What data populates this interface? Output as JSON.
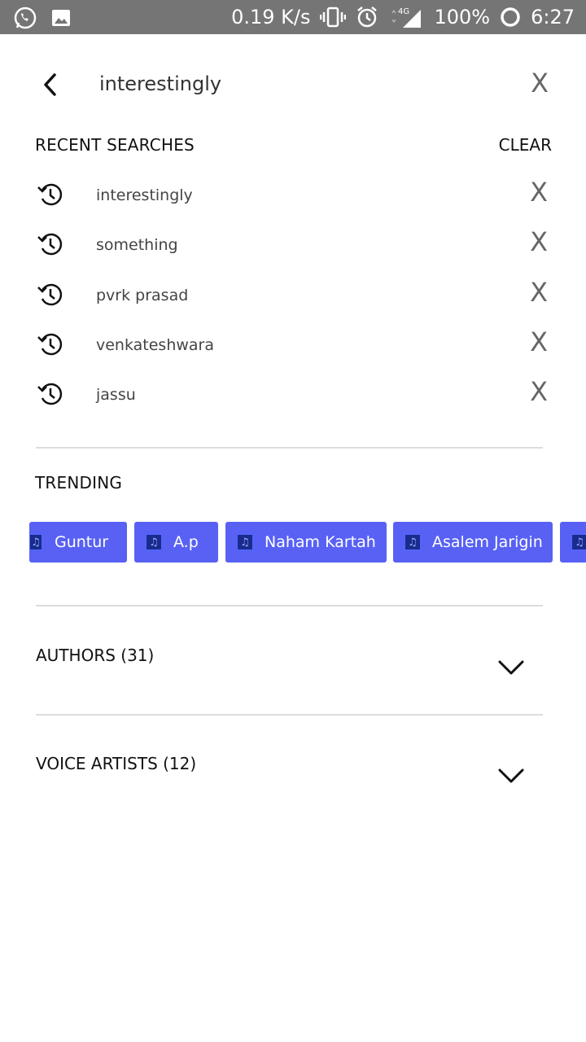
{
  "status_bar": {
    "left_icons": [
      "whatsapp-icon",
      "image-icon"
    ],
    "net_speed": "0.19 K/s",
    "battery": "100%",
    "time": "6:27",
    "network_label": "4G"
  },
  "search": {
    "query": "interestingly",
    "back_icon": "back-arrow-icon",
    "clear_label": "X"
  },
  "recent": {
    "title": "RECENT SEARCHES",
    "clear_label": "CLEAR",
    "items": [
      {
        "label": "interestingly",
        "remove": "X"
      },
      {
        "label": "something",
        "remove": "X"
      },
      {
        "label": "pvrk prasad",
        "remove": "X"
      },
      {
        "label": "venkateshwara",
        "remove": "X"
      },
      {
        "label": "jassu",
        "remove": "X"
      }
    ]
  },
  "trending": {
    "title": "TRENDING",
    "chips": [
      {
        "label": "Guntur"
      },
      {
        "label": "A.p"
      },
      {
        "label": "Naham Kartah"
      },
      {
        "label": "Asalem Jarigin"
      },
      {
        "label": ""
      }
    ],
    "chip_color": "#5861f4"
  },
  "sections": {
    "authors": {
      "title": "AUTHORS (31)"
    },
    "voice_artists": {
      "title": "VOICE ARTISTS (12)"
    }
  }
}
